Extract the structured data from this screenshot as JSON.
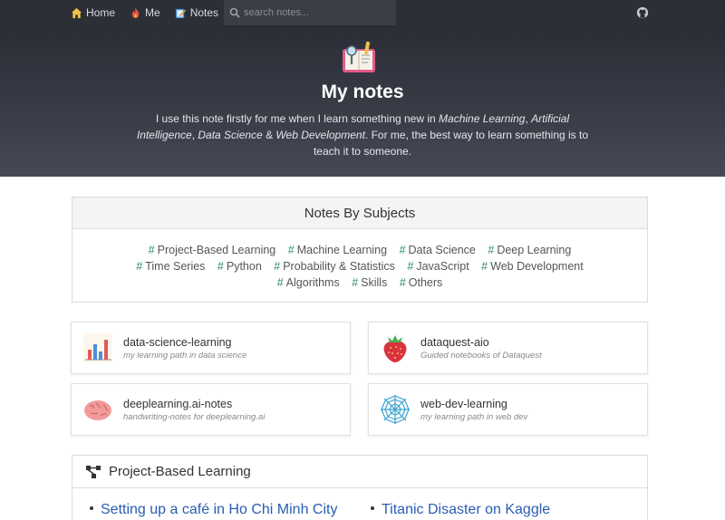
{
  "nav": {
    "home": "Home",
    "me": "Me",
    "notes": "Notes",
    "search_placeholder": "search notes..."
  },
  "hero": {
    "title": "My notes",
    "desc_1": "I use this note firstly for me when I learn something new in ",
    "desc_ml": "Machine Learning",
    "desc_2": ", ",
    "desc_ai": "Artificial Intelligence",
    "desc_3": ", ",
    "desc_ds": "Data Science",
    "desc_4": " & ",
    "desc_wd": "Web Development",
    "desc_5": ". For me, the best way to learn something is to teach it to someone."
  },
  "subjects": {
    "title": "Notes By Subjects",
    "tags": [
      "Project-Based Learning",
      "Machine Learning",
      "Data Science",
      "Deep Learning",
      "Time Series",
      "Python",
      "Probability & Statistics",
      "JavaScript",
      "Web Development",
      "Algorithms",
      "Skills",
      "Others"
    ]
  },
  "cards": [
    {
      "title": "data-science-learning",
      "subtitle": "my learning path in data science",
      "icon": "bar-chart-icon"
    },
    {
      "title": "dataquest-aio",
      "subtitle": "Guided notebooks of Dataquest",
      "icon": "strawberry-icon"
    },
    {
      "title": "deeplearning.ai-notes",
      "subtitle": "handwriting-notes for deeplearning.ai",
      "icon": "brain-icon"
    },
    {
      "title": "web-dev-learning",
      "subtitle": "my learning path in web dev",
      "icon": "spider-web-icon"
    }
  ],
  "project": {
    "title": "Project-Based Learning",
    "items": [
      "Setting up a café in Ho Chi Minh City",
      "Titanic Disaster on Kaggle"
    ]
  },
  "colors": {
    "navbar": "#2c2f36",
    "hero_top": "#2a2d36",
    "tag_hash": "#2e8b6a",
    "link": "#2a5db0"
  }
}
